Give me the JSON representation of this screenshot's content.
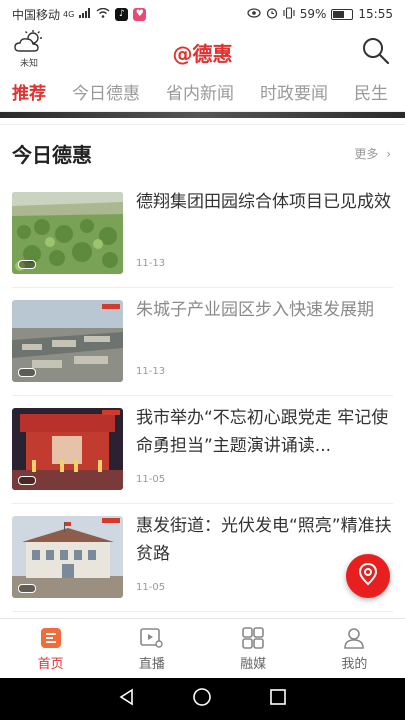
{
  "status_bar": {
    "carrier": "中国移动",
    "network": "4G",
    "battery_percent": "59%",
    "battery_level": 0.59,
    "time": "15:55"
  },
  "header": {
    "weather_label": "未知",
    "title": "@德惠"
  },
  "tabs": [
    {
      "label": "推荐",
      "active": true
    },
    {
      "label": "今日德惠",
      "active": false
    },
    {
      "label": "省内新闻",
      "active": false
    },
    {
      "label": "时政要闻",
      "active": false
    },
    {
      "label": "民生",
      "active": false
    }
  ],
  "section": {
    "title": "今日德惠",
    "more_label": "更多"
  },
  "news": [
    {
      "title": "德翔集团田园综合体项目已见成效",
      "date": "11-13",
      "read": false
    },
    {
      "title": "朱城子产业园区步入快速发展期",
      "date": "11-13",
      "read": true
    },
    {
      "title": "我市举办“不忘初心跟党走 牢记使命勇担当”主题演讲诵读...",
      "date": "11-05",
      "read": false
    },
    {
      "title": "惠发街道：光伏发电“照亮”精准扶贫路",
      "date": "11-05",
      "read": false
    }
  ],
  "bottom_nav": [
    {
      "label": "首页",
      "icon": "home-icon",
      "active": true
    },
    {
      "label": "直播",
      "icon": "live-icon",
      "active": false
    },
    {
      "label": "融媒",
      "icon": "media-grid-icon",
      "active": false
    },
    {
      "label": "我的",
      "icon": "profile-icon",
      "active": false
    }
  ],
  "colors": {
    "accent": "#e0312f",
    "fab": "#e81f1f"
  }
}
